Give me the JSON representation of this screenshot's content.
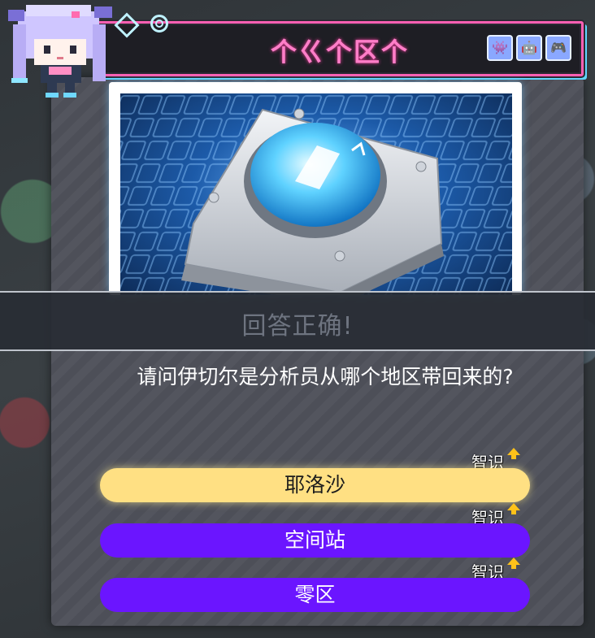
{
  "header": {
    "title": "个ㄍ个区个",
    "icons": [
      "space-invader-icon",
      "robot-icon",
      "gamepad-icon"
    ]
  },
  "banner": {
    "text": "回答正确!"
  },
  "question": {
    "text": "请问伊切尔是分析员从哪个地区带回来的?"
  },
  "options": [
    {
      "label": "耶洛沙",
      "tag": "智识",
      "selected": true
    },
    {
      "label": "空间站",
      "tag": "智识",
      "selected": false
    },
    {
      "label": "零区",
      "tag": "智识",
      "selected": false
    }
  ],
  "colors": {
    "selected_option": "#ffe083",
    "option": "#6b15ff",
    "header_border": "#ff5fb3",
    "header_title": "#ff7ec8",
    "tag_arrow": "#ffc21a"
  }
}
